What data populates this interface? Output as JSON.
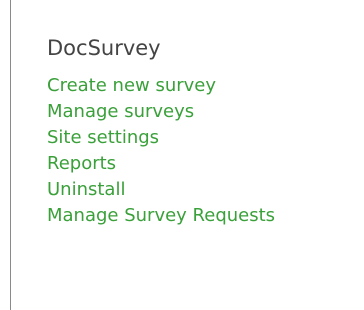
{
  "panel": {
    "title": "DocSurvey",
    "links": [
      {
        "label": "Create new survey"
      },
      {
        "label": "Manage surveys"
      },
      {
        "label": "Site settings"
      },
      {
        "label": "Reports"
      },
      {
        "label": "Uninstall"
      },
      {
        "label": "Manage Survey Requests"
      }
    ]
  },
  "colors": {
    "link": "#3aa03a",
    "title": "#444444",
    "border": "#8a8a8a"
  }
}
